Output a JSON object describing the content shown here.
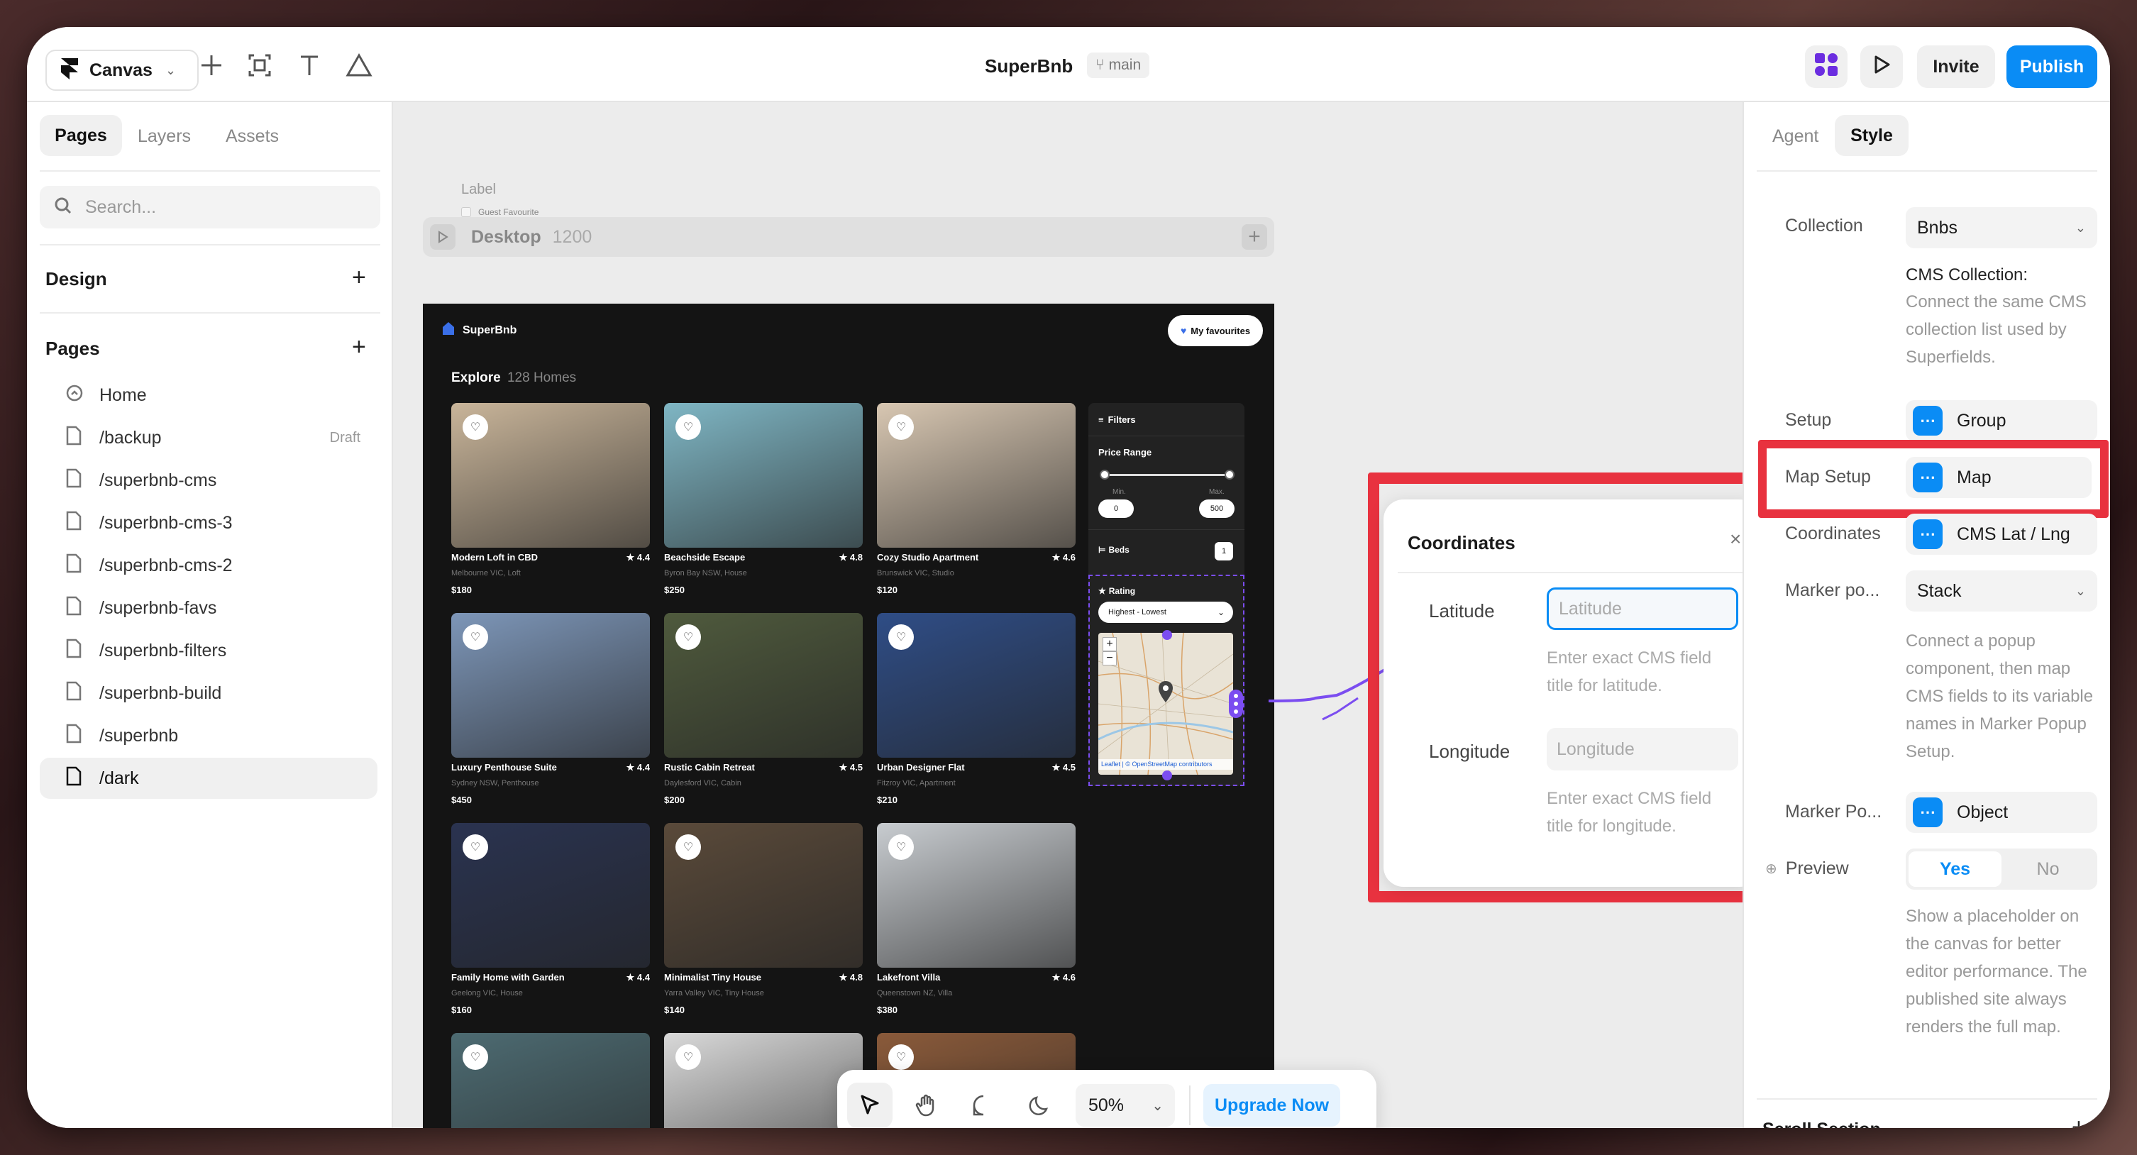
{
  "app": {
    "menu_label": "Canvas",
    "project_title": "SuperBnb",
    "branch": "main",
    "invite_label": "Invite",
    "publish_label": "Publish"
  },
  "left": {
    "tabs": [
      "Pages",
      "Layers",
      "Assets"
    ],
    "search_placeholder": "Search...",
    "design_label": "Design",
    "pages_label": "Pages",
    "pages": [
      {
        "label": "Home",
        "badge": ""
      },
      {
        "label": "/backup",
        "badge": "Draft"
      },
      {
        "label": "/superbnb-cms",
        "badge": ""
      },
      {
        "label": "/superbnb-cms-3",
        "badge": ""
      },
      {
        "label": "/superbnb-cms-2",
        "badge": ""
      },
      {
        "label": "/superbnb-favs",
        "badge": ""
      },
      {
        "label": "/superbnb-filters",
        "badge": ""
      },
      {
        "label": "/superbnb-build",
        "badge": ""
      },
      {
        "label": "/superbnb",
        "badge": ""
      },
      {
        "label": "/dark",
        "badge": ""
      }
    ]
  },
  "canvas": {
    "label_text": "Label",
    "guest_favourite": "Guest Favourite",
    "breakpoint": "Desktop",
    "breakpoint_width": "1200",
    "site": {
      "logo": "SuperBnb",
      "favs": "My favourites",
      "explore": "Explore",
      "count": "128 Homes",
      "listings": [
        {
          "title": "Modern Loft in CBD",
          "rating": "4.4",
          "loc": "Melbourne VIC, Loft",
          "price": "$180",
          "color": "#c9b59a"
        },
        {
          "title": "Beachside Escape",
          "rating": "4.8",
          "loc": "Byron Bay NSW, House",
          "price": "$250",
          "color": "#7fb6c4"
        },
        {
          "title": "Cozy Studio Apartment",
          "rating": "4.6",
          "loc": "Brunswick VIC, Studio",
          "price": "$120",
          "color": "#d8c7b2"
        },
        {
          "title": "Luxury Penthouse Suite",
          "rating": "4.4",
          "loc": "Sydney NSW, Penthouse",
          "price": "$450",
          "color": "#7d96b8"
        },
        {
          "title": "Rustic Cabin Retreat",
          "rating": "4.5",
          "loc": "Daylesford VIC, Cabin",
          "price": "$200",
          "color": "#4f5a3d"
        },
        {
          "title": "Urban Designer Flat",
          "rating": "4.5",
          "loc": "Fitzroy VIC, Apartment",
          "price": "$210",
          "color": "#2f4d86"
        },
        {
          "title": "Family Home with Garden",
          "rating": "4.4",
          "loc": "Geelong VIC, House",
          "price": "$160",
          "color": "#2a3350"
        },
        {
          "title": "Minimalist Tiny House",
          "rating": "4.8",
          "loc": "Yarra Valley VIC, Tiny House",
          "price": "$140",
          "color": "#5a4a3a"
        },
        {
          "title": "Lakefront Villa",
          "rating": "4.6",
          "loc": "Queenstown NZ, Villa",
          "price": "$380",
          "color": "#c8ccd0"
        }
      ],
      "bottom_colors": [
        "#4d6b72",
        "#d9d9d9",
        "#8a5a3a"
      ],
      "filters": {
        "title": "Filters",
        "price_range": "Price Range",
        "min_label": "Min.",
        "max_label": "Max.",
        "min": "0",
        "max": "500",
        "beds": "Beds",
        "beds_val": "1",
        "rating": "Rating",
        "sort": "Highest - Lowest",
        "map_attr": "Leaflet | © OpenStreetMap contributors"
      }
    }
  },
  "toolbar": {
    "zoom": "50%",
    "upgrade": "Upgrade Now"
  },
  "popup": {
    "title": "Coordinates",
    "lat_label": "Latitude",
    "lat_placeholder": "Latitude",
    "lat_help": "Enter exact CMS field title for latitude.",
    "lng_label": "Longitude",
    "lng_placeholder": "Longitude",
    "lng_help": "Enter exact CMS field title for longitude."
  },
  "right": {
    "tabs": [
      "Agent",
      "Style"
    ],
    "collection_label": "Collection",
    "collection_value": "Bnbs",
    "cms_title": "CMS Collection:",
    "cms_desc": "Connect the same CMS collection list used by Superfields.",
    "setup_label": "Setup",
    "setup_value": "Group",
    "map_setup_label": "Map Setup",
    "map_setup_value": "Map",
    "coords_label": "Coordinates",
    "coords_value": "CMS Lat / Lng",
    "marker_pos_label": "Marker po...",
    "marker_pos_value": "Stack",
    "marker_desc": "Connect a popup component, then map CMS fields to its variable names in Marker Popup Setup.",
    "marker_popup_label": "Marker Po...",
    "marker_popup_value": "Object",
    "preview_label": "Preview",
    "yes": "Yes",
    "no": "No",
    "preview_desc": "Show a placeholder on the canvas for better editor performance. The published site always renders the full map.",
    "scroll_section": "Scroll Section"
  },
  "colors": {
    "accent": "#0a8cf5",
    "highlight": "#e8323f",
    "purple": "#7b4df0"
  }
}
